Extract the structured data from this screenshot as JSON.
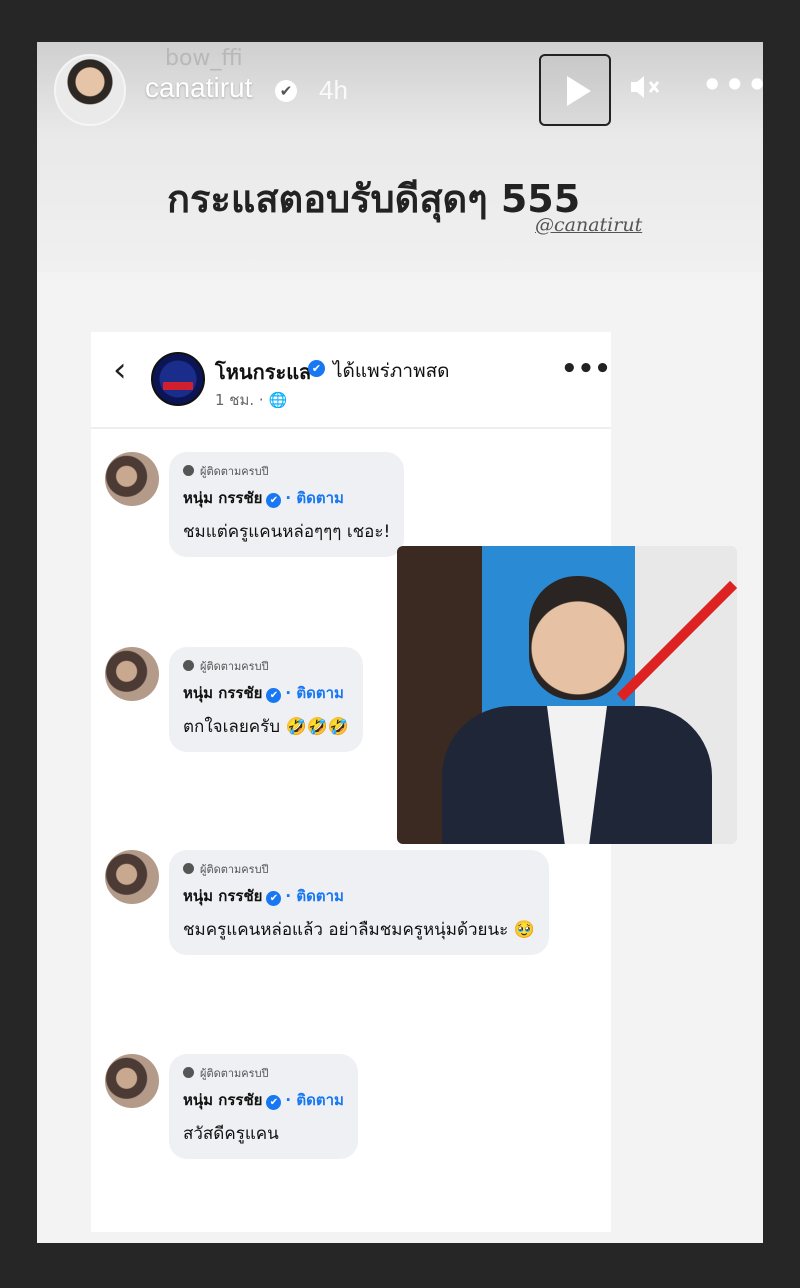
{
  "story": {
    "ghost_username": "bow_ffi",
    "username": "canatirut",
    "time": "4h",
    "headline": "กระแสตอบรับดีสุดๆ 555",
    "watermark": "@canatirut"
  },
  "icons": {
    "verified": "✔",
    "play": "play-icon",
    "mute": "speaker-muted-icon",
    "more": "•••",
    "back": "‹"
  },
  "fb": {
    "page_name": "โหนกระแส",
    "live_text": "ได้แพร่ภาพสด",
    "post_time": "1 ชม. · 🌐",
    "more": "•••",
    "comments": [
      {
        "tag": "ผู้ติดตามครบปี",
        "name": "หนุ่ม กรรชัย",
        "follow": "· ติดตาม",
        "text": "ชมแต่ครูแคนหล่อๆๆๆ   เชอะ!"
      },
      {
        "tag": "ผู้ติดตามครบปี",
        "name": "หนุ่ม กรรชัย",
        "follow": "· ติดตาม",
        "text": "ตกใจเลยครับ 🤣🤣🤣"
      },
      {
        "tag": "ผู้ติดตามครบปี",
        "name": "หนุ่ม กรรชัย",
        "follow": "· ติดตาม",
        "text": "ชมครูแคนหล่อแล้ว อย่าลืมชมครูหนุ่มด้วยนะ 🥹"
      },
      {
        "tag": "ผู้ติดตามครบปี",
        "name": "หนุ่ม กรรชัย",
        "follow": "· ติดตาม",
        "text": "สวัสดีครูแคน"
      }
    ]
  },
  "colors": {
    "background": "#262626",
    "story_bg": "#f3f3f3",
    "fb_blue": "#1877f2",
    "bubble": "#eef0f3"
  }
}
